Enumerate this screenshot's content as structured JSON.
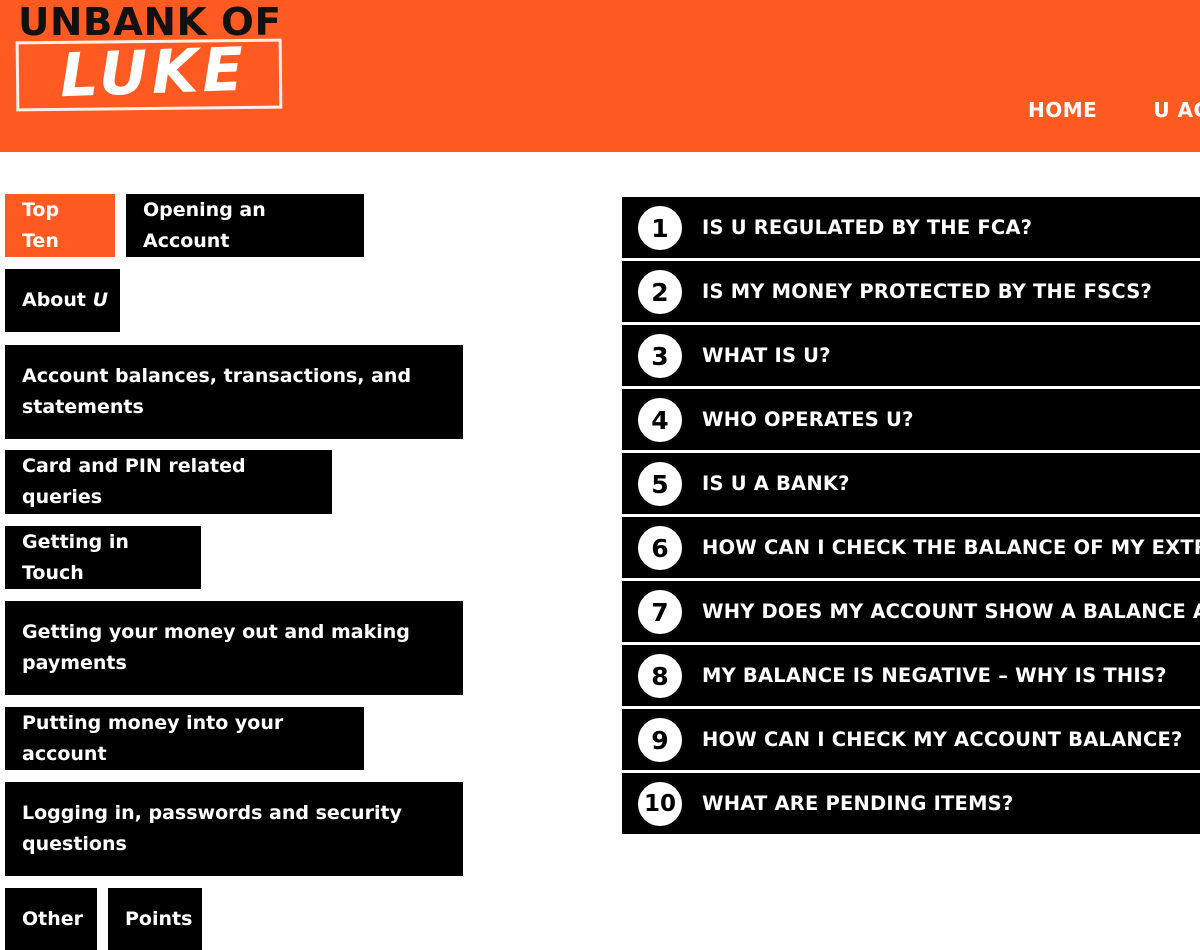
{
  "header": {
    "logo_top": "UNBANK OF",
    "logo_bottom": "LUKE",
    "nav": [
      "HOME",
      "U ACC"
    ],
    "color": "#FF5A22"
  },
  "categories": [
    {
      "label": "Top Ten",
      "active": true
    },
    {
      "label": "Opening an Account"
    },
    {
      "label_prefix": "About ",
      "label_em": "U"
    },
    {
      "label": "Account balances, transactions, and statements"
    },
    {
      "label": "Card and PIN related queries"
    },
    {
      "label": "Getting in Touch"
    },
    {
      "label": "Getting your money out and making payments"
    },
    {
      "label": "Putting money into your account"
    },
    {
      "label": "Logging in, passwords and security questions"
    },
    {
      "label": "Other"
    },
    {
      "label": "Points"
    }
  ],
  "faq": [
    {
      "num": "1",
      "q": "IS U REGULATED BY THE FCA?"
    },
    {
      "num": "2",
      "q": "IS MY MONEY PROTECTED BY THE FSCS?"
    },
    {
      "num": "3",
      "q": "WHAT IS U?"
    },
    {
      "num": "4",
      "q": "WHO OPERATES U?"
    },
    {
      "num": "5",
      "q": "IS U A BANK?"
    },
    {
      "num": "6",
      "q": "HOW CAN I CHECK THE BALANCE OF MY EXTRA A"
    },
    {
      "num": "7",
      "q": "WHY DOES MY ACCOUNT SHOW A BALANCE AND"
    },
    {
      "num": "8",
      "q": "MY BALANCE IS NEGATIVE – WHY IS THIS?"
    },
    {
      "num": "9",
      "q": "HOW CAN I CHECK MY ACCOUNT BALANCE?"
    },
    {
      "num": "10",
      "q": "WHAT ARE PENDING ITEMS?"
    }
  ]
}
